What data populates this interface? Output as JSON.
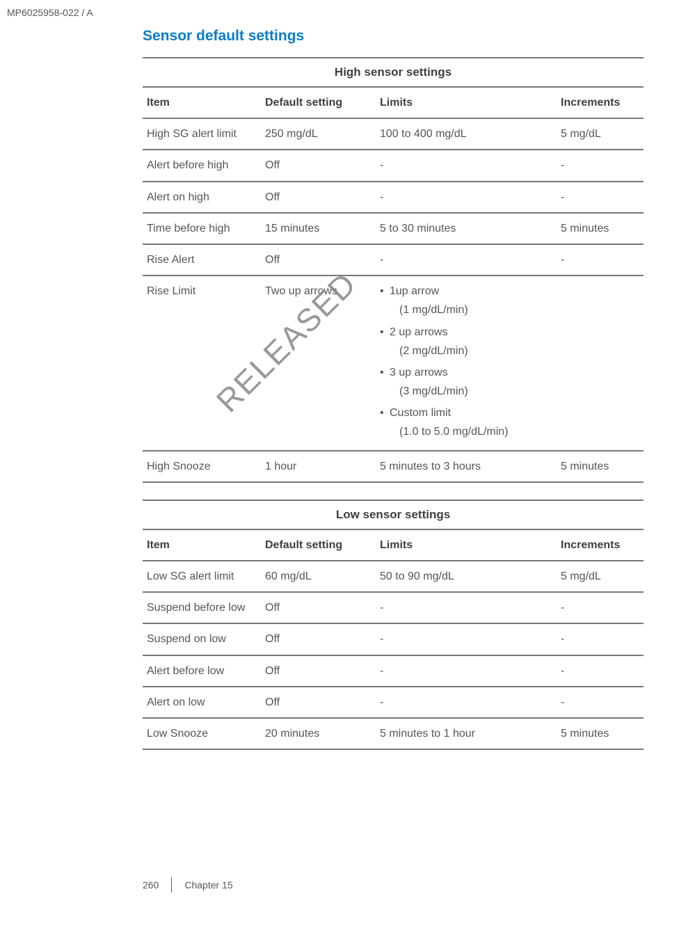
{
  "doc_id": "MP6025958-022 / A",
  "section_title": "Sensor default settings",
  "watermark": "RELEASED",
  "footer": {
    "page_no": "260",
    "chapter": "Chapter 15"
  },
  "tables": [
    {
      "title": "High sensor settings",
      "headers": {
        "item": "Item",
        "default": "Default setting",
        "limits": "Limits",
        "increments": "Increments"
      },
      "rows": [
        {
          "item": "High SG alert limit",
          "default": "250 mg/dL",
          "limits": "100 to 400 mg/dL",
          "increments": "5 mg/dL"
        },
        {
          "item": "Alert before high",
          "default": "Off",
          "limits": "-",
          "increments": "-"
        },
        {
          "item": "Alert on high",
          "default": "Off",
          "limits": "-",
          "increments": "-"
        },
        {
          "item": "Time before high",
          "default": "15 minutes",
          "limits": "5 to 30 minutes",
          "increments": "5 minutes"
        },
        {
          "item": "Rise Alert",
          "default": "Off",
          "limits": "-",
          "increments": "-"
        },
        {
          "item": "Rise Limit",
          "default": "Two up arrows",
          "limits_list": [
            {
              "a": "1up arrow",
              "b": "(1 mg/dL/min)"
            },
            {
              "a": "2 up arrows",
              "b": "(2 mg/dL/min)"
            },
            {
              "a": "3 up arrows",
              "b": "(3 mg/dL/min)"
            },
            {
              "a": "Custom limit",
              "b": "(1.0 to 5.0 mg/dL/min)"
            }
          ],
          "increments": ""
        },
        {
          "item": "High Snooze",
          "default": "1 hour",
          "limits": "5 minutes to 3 hours",
          "increments": "5 minutes"
        }
      ]
    },
    {
      "title": "Low sensor settings",
      "headers": {
        "item": "Item",
        "default": "Default setting",
        "limits": "Limits",
        "increments": "Increments"
      },
      "rows": [
        {
          "item": "Low SG alert limit",
          "default": "60 mg/dL",
          "limits": "50 to 90 mg/dL",
          "increments": "5 mg/dL"
        },
        {
          "item": "Suspend before low",
          "default": "Off",
          "limits": "-",
          "increments": "-"
        },
        {
          "item": "Suspend on low",
          "default": "Off",
          "limits": "-",
          "increments": "-"
        },
        {
          "item": "Alert before low",
          "default": "Off",
          "limits": "-",
          "increments": "-"
        },
        {
          "item": "Alert on low",
          "default": "Off",
          "limits": "-",
          "increments": "-"
        },
        {
          "item": "Low Snooze",
          "default": "20 minutes",
          "limits": "5 minutes to 1 hour",
          "increments": "5 minutes"
        }
      ]
    }
  ],
  "chart_data": [
    {
      "type": "table",
      "title": "High sensor settings",
      "columns": [
        "Item",
        "Default setting",
        "Limits",
        "Increments"
      ],
      "rows": [
        [
          "High SG alert limit",
          "250 mg/dL",
          "100 to 400 mg/dL",
          "5 mg/dL"
        ],
        [
          "Alert before high",
          "Off",
          "-",
          "-"
        ],
        [
          "Alert on high",
          "Off",
          "-",
          "-"
        ],
        [
          "Time before high",
          "15 minutes",
          "5 to 30 minutes",
          "5 minutes"
        ],
        [
          "Rise Alert",
          "Off",
          "-",
          "-"
        ],
        [
          "Rise Limit",
          "Two up arrows",
          "1up arrow (1 mg/dL/min); 2 up arrows (2 mg/dL/min); 3 up arrows (3 mg/dL/min); Custom limit (1.0 to 5.0 mg/dL/min)",
          ""
        ],
        [
          "High Snooze",
          "1 hour",
          "5 minutes to 3 hours",
          "5 minutes"
        ]
      ]
    },
    {
      "type": "table",
      "title": "Low sensor settings",
      "columns": [
        "Item",
        "Default setting",
        "Limits",
        "Increments"
      ],
      "rows": [
        [
          "Low SG alert limit",
          "60 mg/dL",
          "50 to 90 mg/dL",
          "5 mg/dL"
        ],
        [
          "Suspend before low",
          "Off",
          "-",
          "-"
        ],
        [
          "Suspend on low",
          "Off",
          "-",
          "-"
        ],
        [
          "Alert before low",
          "Off",
          "-",
          "-"
        ],
        [
          "Alert on low",
          "Off",
          "-",
          "-"
        ],
        [
          "Low Snooze",
          "20 minutes",
          "5 minutes to 1 hour",
          "5 minutes"
        ]
      ]
    }
  ]
}
